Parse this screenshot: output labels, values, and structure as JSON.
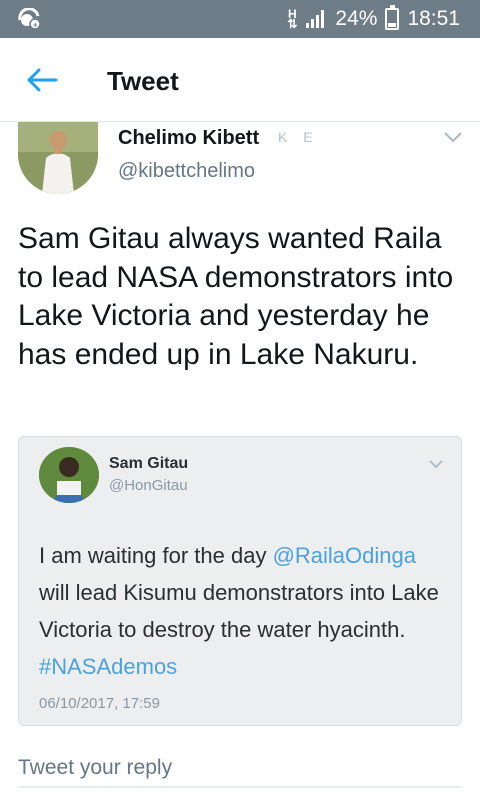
{
  "status_bar": {
    "network": "H",
    "battery": "24%",
    "time": "18:51",
    "battery_level": 0.24
  },
  "app_bar": {
    "title": "Tweet",
    "back_icon": "arrow-left-icon",
    "accent": "#1da1f2"
  },
  "tweet": {
    "author_name": "Chelimo Kibett",
    "author_flags": "K E",
    "author_handle": "@kibettchelimo",
    "text": "Sam Gitau always wanted Raila to lead NASA demonstrators into Lake Victoria and yesterday he has ended up in Lake Nakuru."
  },
  "quoted": {
    "author_name": "Sam Gitau",
    "author_handle": "@HonGitau",
    "text_1": "I am waiting for the day ",
    "mention": "@RailaOdinga",
    "text_2": " will lead Kisumu demonstrators into Lake Victoria to destroy the water hyacinth. ",
    "hashtag": "#NASAdemos",
    "date": "06/10/2017, 17:59",
    "link_color": "#4aa3df"
  },
  "reply": {
    "placeholder": "Tweet your reply"
  }
}
